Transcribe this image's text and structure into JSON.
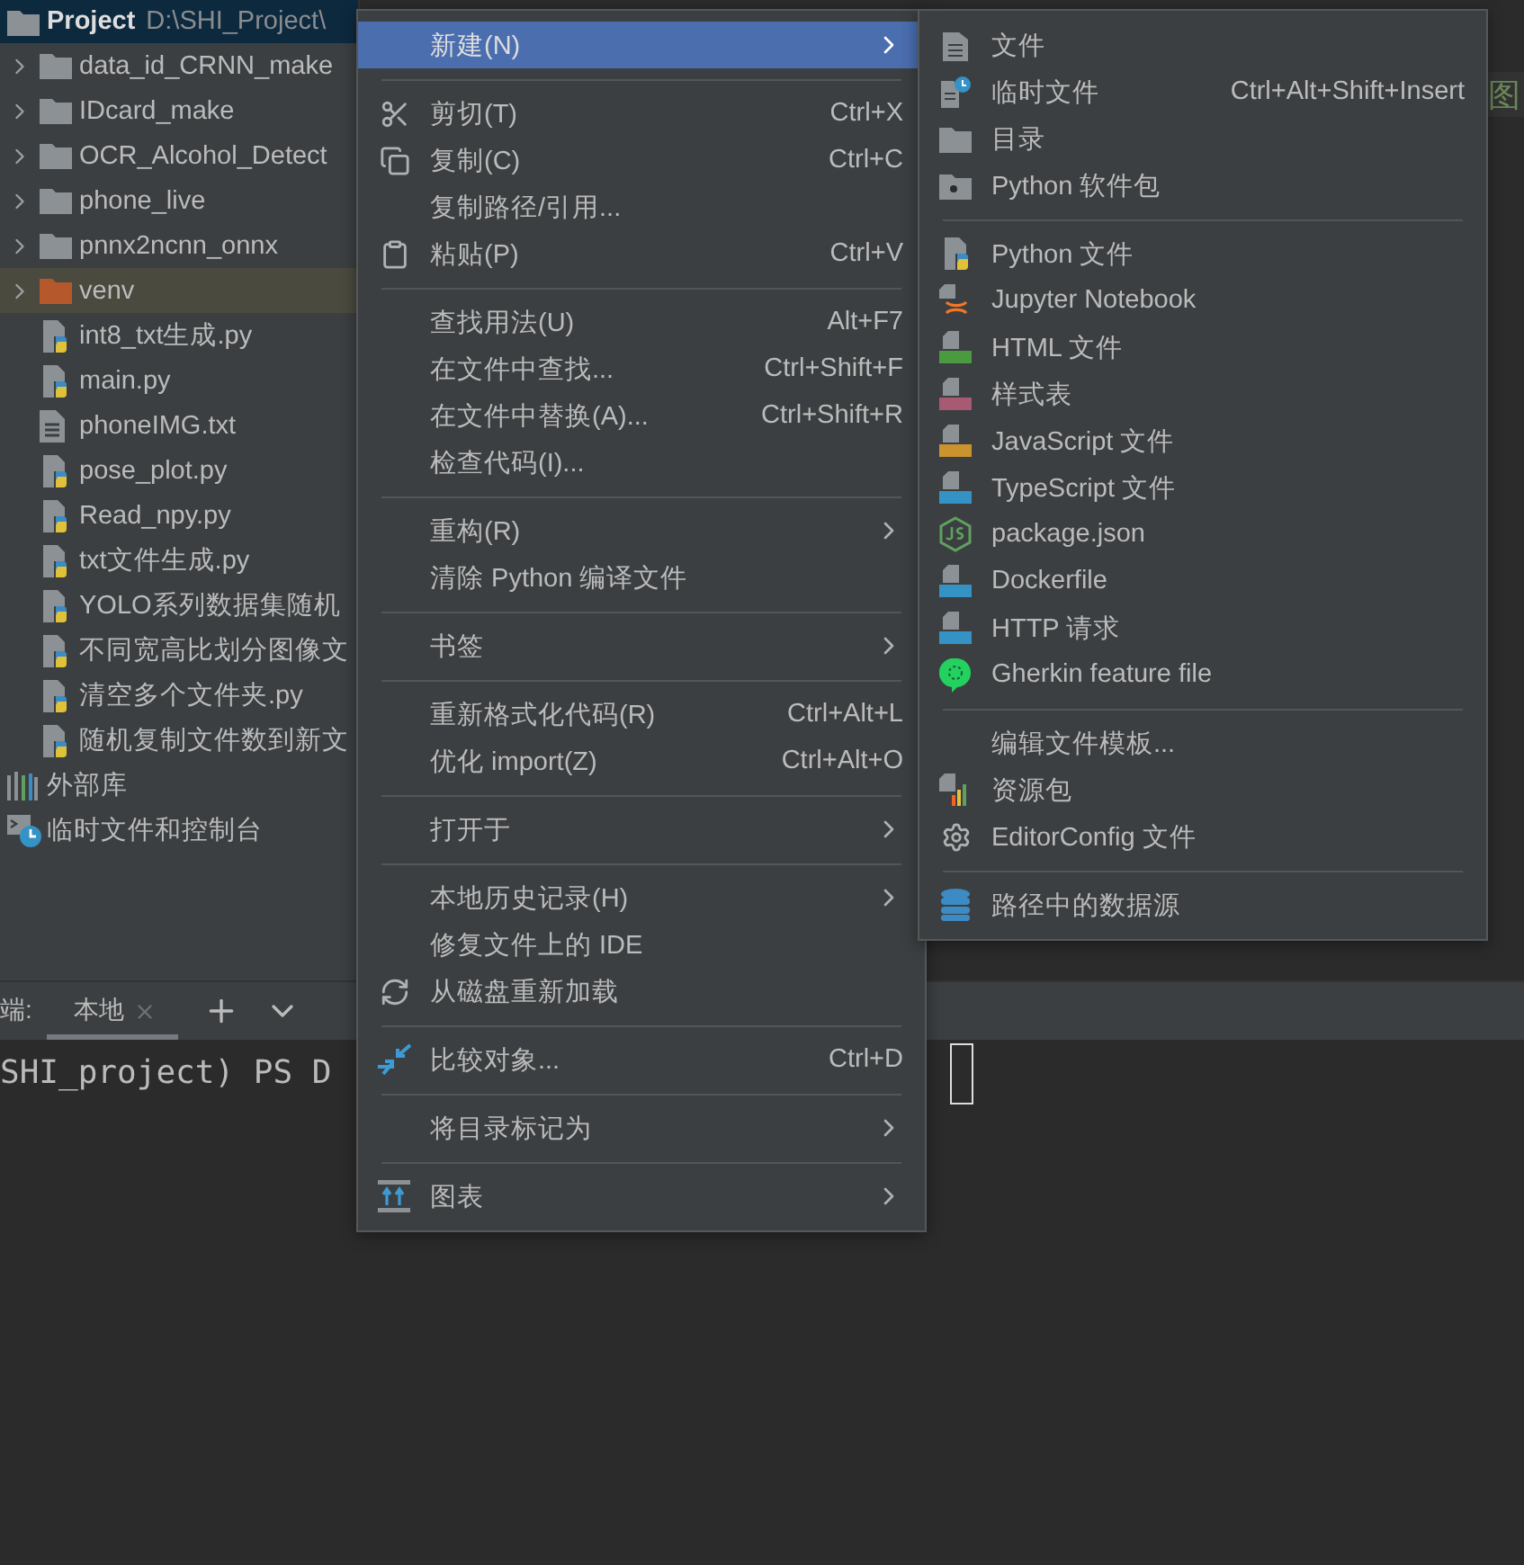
{
  "project_tree": {
    "items": [
      {
        "kind": "project",
        "label": "Project",
        "path": "D:\\SHI_Project\\",
        "expanded": true,
        "children": [
          {
            "kind": "folder",
            "label": "data_id_CRNN_make",
            "expanded": false,
            "selected": false
          },
          {
            "kind": "folder",
            "label": "IDcard_make",
            "expanded": false,
            "selected": false
          },
          {
            "kind": "folder",
            "label": "OCR_Alcohol_Detect",
            "expanded": false,
            "selected": false
          },
          {
            "kind": "folder",
            "label": "phone_live",
            "expanded": false,
            "selected": false
          },
          {
            "kind": "folder",
            "label": "pnnx2ncnn_onnx",
            "expanded": false,
            "selected": false
          },
          {
            "kind": "excluded_folder",
            "label": "venv",
            "expanded": false,
            "selected": true
          },
          {
            "kind": "python",
            "label": "int8_txt生成.py",
            "selected": false
          },
          {
            "kind": "python",
            "label": "main.py",
            "selected": false
          },
          {
            "kind": "text",
            "label": "phoneIMG.txt",
            "selected": false
          },
          {
            "kind": "python",
            "label": "pose_plot.py",
            "selected": false
          },
          {
            "kind": "python",
            "label": "Read_npy.py",
            "selected": false
          },
          {
            "kind": "python",
            "label": "txt文件生成.py",
            "selected": false
          },
          {
            "kind": "python",
            "label": "YOLO系列数据集随机",
            "selected": false
          },
          {
            "kind": "python",
            "label": "不同宽高比划分图像文",
            "selected": false
          },
          {
            "kind": "python",
            "label": "清空多个文件夹.py",
            "selected": false
          },
          {
            "kind": "python",
            "label": "随机复制文件数到新文",
            "selected": false
          }
        ]
      },
      {
        "kind": "library",
        "label": "外部库",
        "selected": false
      },
      {
        "kind": "scratches",
        "label": "临时文件和控制台",
        "selected": false
      }
    ]
  },
  "editor": {
    "visible_text": "图"
  },
  "terminal": {
    "title": "端:",
    "tabs": [
      {
        "label": "本地",
        "selected": true
      }
    ],
    "line": "SHI_project) PS D"
  },
  "context_menu": {
    "items": [
      {
        "kind": "item",
        "label": "新建(N)",
        "submenu": true,
        "selected": true
      },
      {
        "kind": "separator"
      },
      {
        "kind": "item",
        "label": "剪切(T)",
        "shortcut": "Ctrl+X",
        "submenu": false,
        "selected": false
      },
      {
        "kind": "item",
        "label": "复制(C)",
        "shortcut": "Ctrl+C",
        "submenu": false,
        "selected": false
      },
      {
        "kind": "item",
        "label": "复制路径/引用...",
        "submenu": false,
        "selected": false
      },
      {
        "kind": "item",
        "label": "粘贴(P)",
        "shortcut": "Ctrl+V",
        "submenu": false,
        "selected": false
      },
      {
        "kind": "separator"
      },
      {
        "kind": "item",
        "label": "查找用法(U)",
        "shortcut": "Alt+F7",
        "submenu": false,
        "selected": false
      },
      {
        "kind": "item",
        "label": "在文件中查找...",
        "shortcut": "Ctrl+Shift+F",
        "submenu": false,
        "selected": false
      },
      {
        "kind": "item",
        "label": "在文件中替换(A)...",
        "shortcut": "Ctrl+Shift+R",
        "submenu": false,
        "selected": false
      },
      {
        "kind": "item",
        "label": "检查代码(I)...",
        "submenu": false,
        "selected": false
      },
      {
        "kind": "separator"
      },
      {
        "kind": "item",
        "label": "重构(R)",
        "submenu": true,
        "selected": false
      },
      {
        "kind": "item",
        "label": "清除 Python 编译文件",
        "submenu": false,
        "selected": false
      },
      {
        "kind": "separator"
      },
      {
        "kind": "item",
        "label": "书签",
        "submenu": true,
        "selected": false
      },
      {
        "kind": "separator"
      },
      {
        "kind": "item",
        "label": "重新格式化代码(R)",
        "shortcut": "Ctrl+Alt+L",
        "submenu": false,
        "selected": false
      },
      {
        "kind": "item",
        "label": "优化 import(Z)",
        "shortcut": "Ctrl+Alt+O",
        "submenu": false,
        "selected": false
      },
      {
        "kind": "separator"
      },
      {
        "kind": "item",
        "label": "打开于",
        "submenu": true,
        "selected": false
      },
      {
        "kind": "separator"
      },
      {
        "kind": "item",
        "label": "本地历史记录(H)",
        "submenu": true,
        "selected": false
      },
      {
        "kind": "item",
        "label": "修复文件上的 IDE",
        "submenu": false,
        "selected": false
      },
      {
        "kind": "item",
        "label": "从磁盘重新加载",
        "submenu": false,
        "selected": false
      },
      {
        "kind": "separator"
      },
      {
        "kind": "item",
        "label": "比较对象...",
        "shortcut": "Ctrl+D",
        "submenu": false,
        "selected": false
      },
      {
        "kind": "separator"
      },
      {
        "kind": "item",
        "label": "将目录标记为",
        "submenu": true,
        "selected": false
      },
      {
        "kind": "separator"
      },
      {
        "kind": "item",
        "label": "图表",
        "submenu": true,
        "selected": false
      }
    ]
  },
  "new_submenu": {
    "items": [
      {
        "kind": "item",
        "label": "文件",
        "selected": false
      },
      {
        "kind": "item",
        "label": "临时文件",
        "shortcut": "Ctrl+Alt+Shift+Insert",
        "selected": false
      },
      {
        "kind": "item",
        "label": "目录",
        "selected": false
      },
      {
        "kind": "item",
        "label": "Python 软件包",
        "selected": false
      },
      {
        "kind": "separator"
      },
      {
        "kind": "item",
        "label": "Python 文件",
        "selected": false
      },
      {
        "kind": "item",
        "label": "Jupyter Notebook",
        "selected": false
      },
      {
        "kind": "item",
        "label": "HTML 文件",
        "selected": false
      },
      {
        "kind": "item",
        "label": "样式表",
        "selected": false
      },
      {
        "kind": "item",
        "label": "JavaScript 文件",
        "selected": false
      },
      {
        "kind": "item",
        "label": "TypeScript 文件",
        "selected": false
      },
      {
        "kind": "item",
        "label": "package.json",
        "selected": false
      },
      {
        "kind": "item",
        "label": "Dockerfile",
        "selected": false
      },
      {
        "kind": "item",
        "label": "HTTP 请求",
        "selected": false
      },
      {
        "kind": "item",
        "label": "Gherkin feature file",
        "selected": false
      },
      {
        "kind": "separator"
      },
      {
        "kind": "item",
        "label": "编辑文件模板...",
        "selected": false
      },
      {
        "kind": "item",
        "label": "资源包",
        "selected": false
      },
      {
        "kind": "item",
        "label": "EditorConfig 文件",
        "selected": false
      },
      {
        "kind": "separator"
      },
      {
        "kind": "item",
        "label": "路径中的数据源",
        "selected": false
      }
    ]
  }
}
